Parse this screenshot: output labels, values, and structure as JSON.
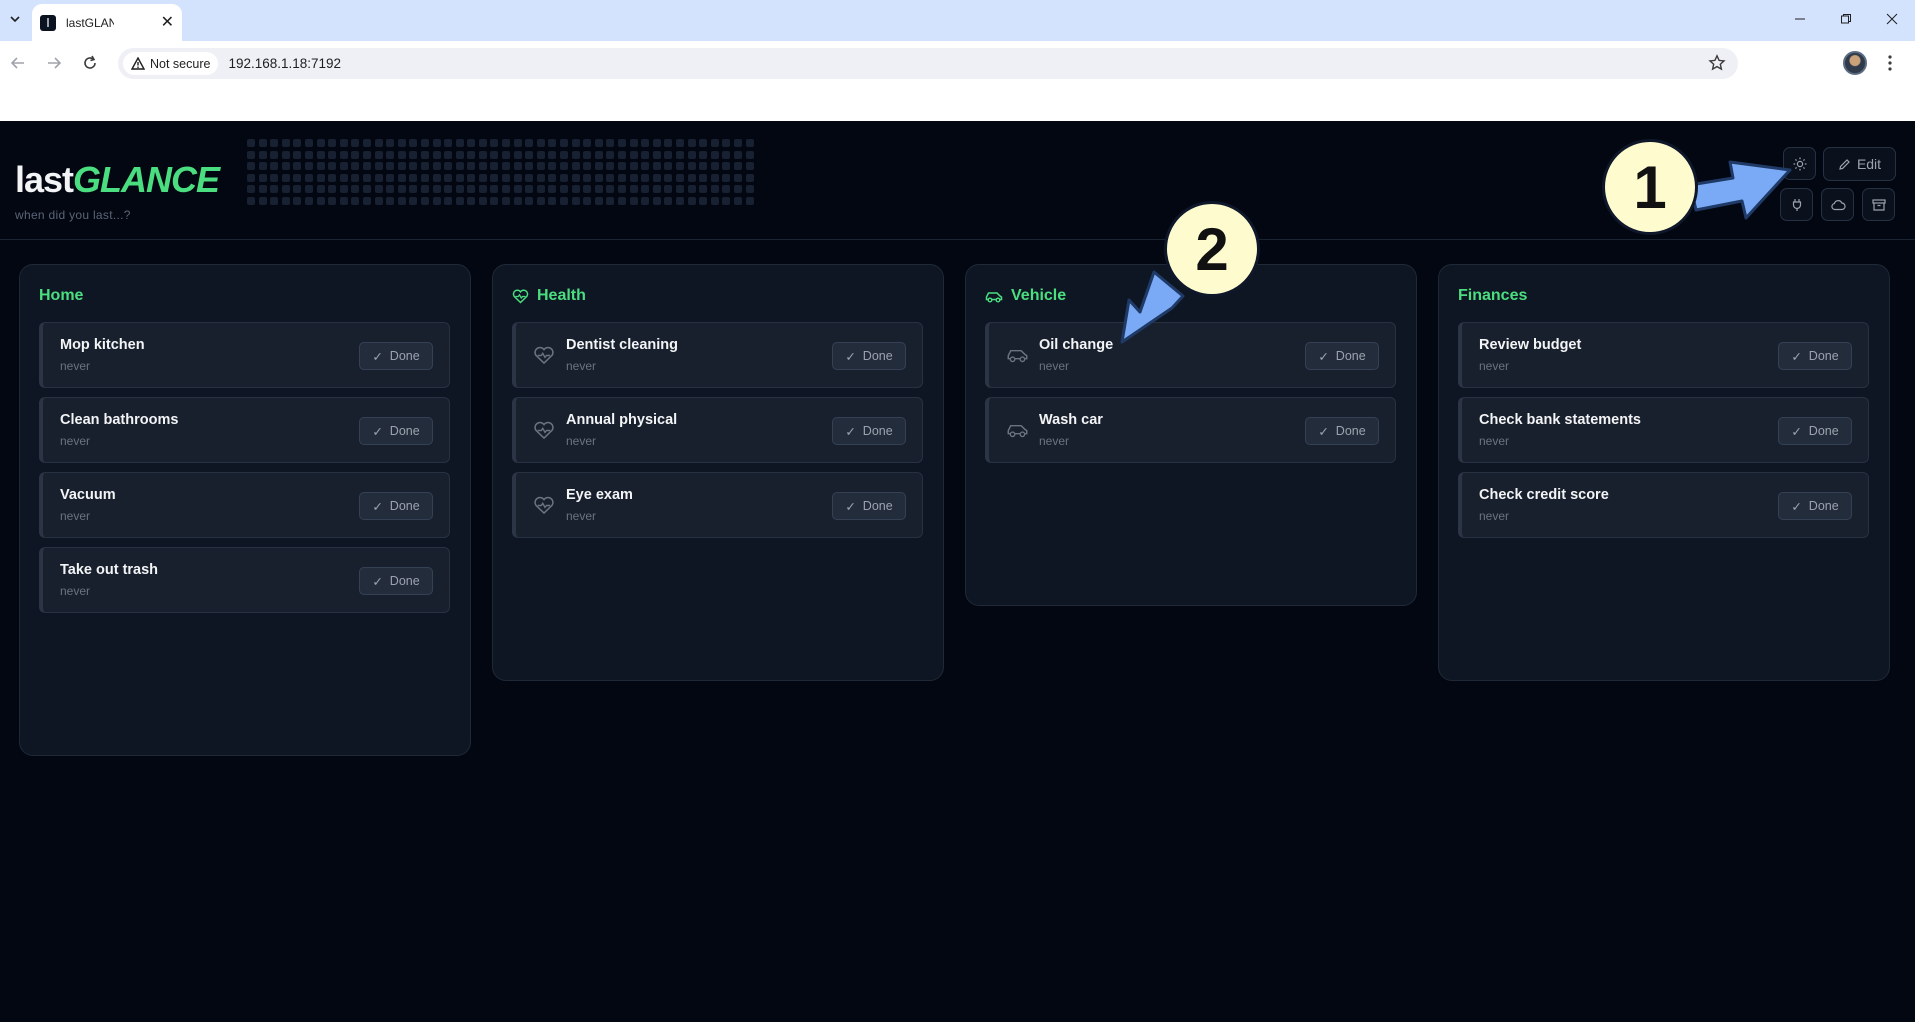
{
  "browser": {
    "tab_title": "lastGLANCE",
    "security_label": "Not secure",
    "url": "192.168.1.18:7192"
  },
  "app": {
    "logo_last": "last",
    "logo_glance": "GLANCE",
    "tagline": "when did you last...?",
    "edit_label": "Edit"
  },
  "annotations": {
    "callout_1": "1",
    "callout_2": "2"
  },
  "done_label": "Done",
  "categories": [
    {
      "title": "Home",
      "icon": "none",
      "items": [
        {
          "name": "Mop kitchen",
          "last": "never"
        },
        {
          "name": "Clean bathrooms",
          "last": "never"
        },
        {
          "name": "Vacuum",
          "last": "never"
        },
        {
          "name": "Take out trash",
          "last": "never"
        }
      ]
    },
    {
      "title": "Health",
      "icon": "heart-pulse-icon",
      "items": [
        {
          "name": "Dentist cleaning",
          "last": "never"
        },
        {
          "name": "Annual physical",
          "last": "never"
        },
        {
          "name": "Eye exam",
          "last": "never"
        }
      ]
    },
    {
      "title": "Vehicle",
      "icon": "car-icon",
      "items": [
        {
          "name": "Oil change",
          "last": "never"
        },
        {
          "name": "Wash car",
          "last": "never"
        }
      ]
    },
    {
      "title": "Finances",
      "icon": "none",
      "items": [
        {
          "name": "Review budget",
          "last": "never"
        },
        {
          "name": "Check bank statements",
          "last": "never"
        },
        {
          "name": "Check credit score",
          "last": "never"
        }
      ]
    }
  ],
  "colors": {
    "accent": "#4ade80",
    "background": "#030712",
    "card": "#0f1623",
    "callout": "#fefccf",
    "arrow": "#7aaaf5"
  }
}
